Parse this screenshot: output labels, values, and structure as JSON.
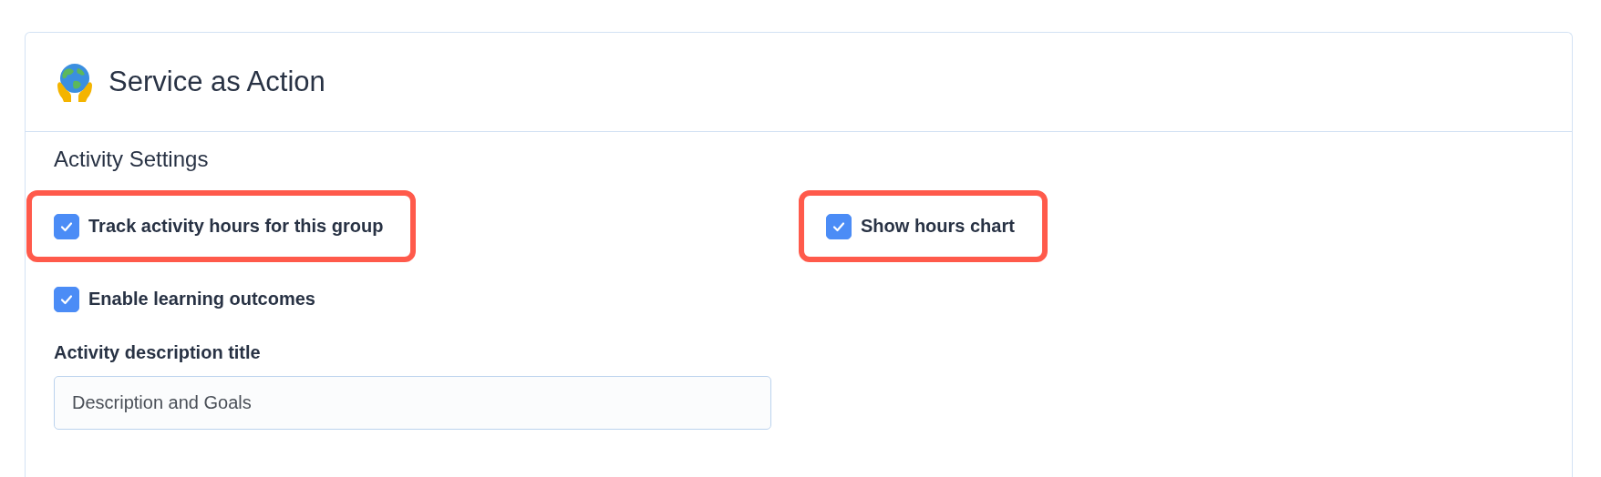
{
  "card": {
    "title": "Service as Action",
    "section_title": "Activity Settings",
    "checkboxes": [
      {
        "label": "Track activity hours for this group",
        "checked": true,
        "highlighted": true
      },
      {
        "label": "Show hours chart",
        "checked": true,
        "highlighted": true
      },
      {
        "label": "Enable learning outcomes",
        "checked": true,
        "highlighted": false
      }
    ],
    "field": {
      "label": "Activity description title",
      "value": "Description and Goals"
    }
  }
}
